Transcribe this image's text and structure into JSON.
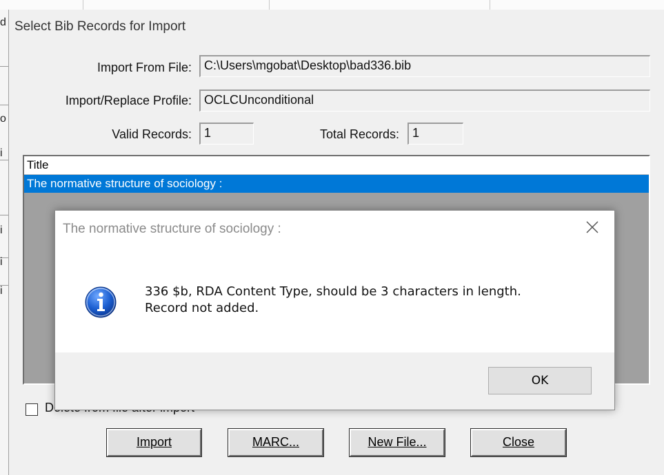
{
  "background_app": {
    "left_chars": [
      "d",
      "o",
      "i",
      "i",
      "i",
      "i"
    ]
  },
  "dialog": {
    "title": "Select Bib Records for Import",
    "import_from_file": {
      "label": "Import From File:",
      "value": "C:\\Users\\mgobat\\Desktop\\bad336.bib"
    },
    "profile": {
      "label": "Import/Replace Profile:",
      "value": "OCLCUnconditional"
    },
    "valid_records": {
      "label": "Valid Records:",
      "value": "1"
    },
    "total_records": {
      "label": "Total Records:",
      "value": "1"
    },
    "list": {
      "header": "Title",
      "rows": [
        "The normative structure of sociology :"
      ]
    },
    "delete_checkbox": {
      "label": "Delete from file after import",
      "checked": false
    },
    "buttons": {
      "import": "Import",
      "marc": "MARC...",
      "new_file": "New File...",
      "close": "Close"
    }
  },
  "message_box": {
    "title": "The normative structure of sociology :",
    "line1": "336 $b, RDA Content Type, should be 3 characters in length.",
    "line2": "Record not added.",
    "ok_label": "OK",
    "icon": "info-icon",
    "accent_color": "#0078d7"
  }
}
